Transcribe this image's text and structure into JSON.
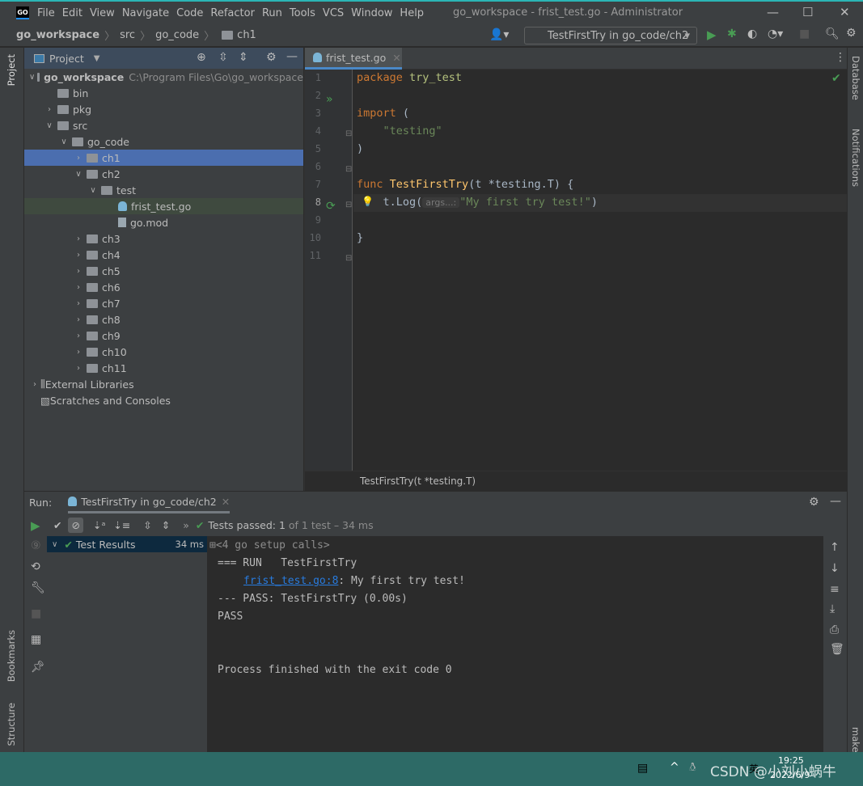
{
  "window": {
    "logo": "GO",
    "title": "go_workspace - frist_test.go - Administrator"
  },
  "menu": [
    "File",
    "Edit",
    "View",
    "Navigate",
    "Code",
    "Refactor",
    "Run",
    "Tools",
    "VCS",
    "Window",
    "Help"
  ],
  "breadcrumb": [
    "go_workspace",
    "src",
    "go_code",
    "ch1"
  ],
  "run_config": "TestFirstTry in go_code/ch2",
  "left_strip": {
    "project": "Project",
    "bookmarks": "Bookmarks",
    "structure": "Structure"
  },
  "right_strip": {
    "database": "Database",
    "notifications": "Notifications",
    "make": "make"
  },
  "project": {
    "title": "Project",
    "tree": [
      {
        "label": "go_workspace",
        "path": "C:\\Program Files\\Go\\go_workspace",
        "level": 0,
        "type": "folder",
        "open": true,
        "bold": true
      },
      {
        "label": "bin",
        "level": 1,
        "type": "folder"
      },
      {
        "label": "pkg",
        "level": 1,
        "type": "folder",
        "closed": true
      },
      {
        "label": "src",
        "level": 1,
        "type": "folder",
        "open": true
      },
      {
        "label": "go_code",
        "level": 2,
        "type": "folder",
        "open": true
      },
      {
        "label": "ch1",
        "level": 3,
        "type": "folder",
        "closed": true,
        "selected": true
      },
      {
        "label": "ch2",
        "level": 3,
        "type": "folder",
        "open": true
      },
      {
        "label": "test",
        "level": 4,
        "type": "folder",
        "open": true
      },
      {
        "label": "frist_test.go",
        "level": 5,
        "type": "go",
        "current": true
      },
      {
        "label": "go.mod",
        "level": 5,
        "type": "file"
      },
      {
        "label": "ch3",
        "level": 3,
        "type": "folder",
        "closed": true
      },
      {
        "label": "ch4",
        "level": 3,
        "type": "folder",
        "closed": true
      },
      {
        "label": "ch5",
        "level": 3,
        "type": "folder",
        "closed": true
      },
      {
        "label": "ch6",
        "level": 3,
        "type": "folder",
        "closed": true
      },
      {
        "label": "ch7",
        "level": 3,
        "type": "folder",
        "closed": true
      },
      {
        "label": "ch8",
        "level": 3,
        "type": "folder",
        "closed": true
      },
      {
        "label": "ch9",
        "level": 3,
        "type": "folder",
        "closed": true
      },
      {
        "label": "ch10",
        "level": 3,
        "type": "folder",
        "closed": true
      },
      {
        "label": "ch11",
        "level": 3,
        "type": "folder",
        "closed": true
      },
      {
        "label": "External Libraries",
        "level": 0,
        "type": "lib",
        "closed": true
      },
      {
        "label": "Scratches and Consoles",
        "level": 0,
        "type": "scratch"
      }
    ]
  },
  "editor": {
    "tab": "frist_test.go",
    "current_line": 8,
    "lines": [
      [
        [
          "kw",
          "package "
        ],
        [
          "fn2",
          "try_test"
        ]
      ],
      [],
      [
        [
          "kw",
          "import "
        ],
        [
          "ty",
          "("
        ]
      ],
      [
        [
          "ty",
          "    "
        ],
        [
          "str",
          "\"testing\""
        ]
      ],
      [
        [
          "ty",
          ")"
        ]
      ],
      [],
      [
        [
          "kw",
          "func "
        ],
        [
          "fn",
          "TestFirstTry"
        ],
        [
          "ty",
          "(t *testing.T) {"
        ]
      ],
      [
        [
          "ty",
          "    t.Log("
        ],
        [
          "hint",
          "args...:"
        ],
        [
          "str",
          "\"My first try test!\""
        ],
        [
          "ty",
          ")"
        ]
      ],
      [],
      [
        [
          "ty",
          "}"
        ]
      ],
      []
    ],
    "footer_crumb": "TestFirstTry(t *testing.T)"
  },
  "run": {
    "label": "Run:",
    "tab": "TestFirstTry in go_code/ch2",
    "status_prefix": "Tests passed:",
    "status_count": "1",
    "status_rest": "of 1 test – 34 ms",
    "tree_root": "Test Results",
    "tree_time": "34 ms",
    "console": [
      {
        "text": "<4 go setup calls>",
        "kind": "fold"
      },
      {
        "text": "=== RUN   TestFirstTry"
      },
      {
        "link": "frist_test.go:8",
        "text": ": My first try test!"
      },
      {
        "text": "--- PASS: TestFirstTry (0.00s)"
      },
      {
        "text": "PASS"
      },
      {
        "text": ""
      },
      {
        "text": ""
      },
      {
        "text": "Process finished with the exit code 0"
      }
    ]
  },
  "taskbar": {
    "time": "19:25",
    "date": "2022/6/9",
    "ime": "英",
    "watermark": "CSDN @小刘小蜗牛"
  },
  "colors": {
    "keyword": "#CC7832",
    "function": "#FFC66D",
    "string": "#6A8759",
    "text": "#A9B7C6",
    "selection": "#4B6EAF",
    "success": "#499C54",
    "link": "#287BDE"
  }
}
